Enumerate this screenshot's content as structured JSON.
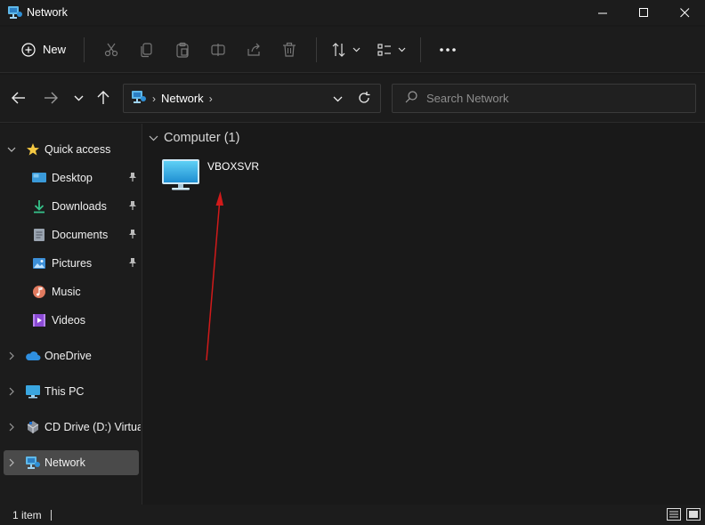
{
  "window": {
    "title": "Network",
    "controls": {
      "minimize": "minimize-icon",
      "maximize": "maximize-icon",
      "close": "close-icon"
    }
  },
  "toolbar": {
    "new_label": "New",
    "icons": [
      "cut-icon",
      "copy-icon",
      "paste-icon",
      "rename-icon",
      "share-icon",
      "delete-icon",
      "sort-icon",
      "view-icon",
      "more-icon"
    ]
  },
  "address": {
    "crumbs": [
      "Network"
    ],
    "search_placeholder": "Search Network"
  },
  "sidebar": {
    "items": [
      {
        "label": "Quick access",
        "icon": "star-icon",
        "expandable": true,
        "expanded": true
      },
      {
        "label": "Desktop",
        "icon": "desktop-folder-icon",
        "pinned": true
      },
      {
        "label": "Downloads",
        "icon": "downloads-icon",
        "pinned": true
      },
      {
        "label": "Documents",
        "icon": "documents-icon",
        "pinned": true
      },
      {
        "label": "Pictures",
        "icon": "pictures-icon",
        "pinned": true
      },
      {
        "label": "Music",
        "icon": "music-icon"
      },
      {
        "label": "Videos",
        "icon": "videos-icon"
      },
      {
        "label": "OneDrive",
        "icon": "cloud-icon",
        "expandable": true
      },
      {
        "label": "This PC",
        "icon": "pc-icon",
        "expandable": true
      },
      {
        "label": "CD Drive (D:) VirtualBox Guest Additions",
        "icon": "cd-drive-icon",
        "expandable": true
      },
      {
        "label": "Network",
        "icon": "network-icon",
        "expandable": true,
        "selected": true
      }
    ]
  },
  "content": {
    "group_title": "Computer (1)",
    "items": [
      {
        "label": "VBOXSVR",
        "icon": "computer-icon"
      }
    ]
  },
  "status": {
    "item_count": "1 item"
  },
  "colors": {
    "background": "#191919",
    "panel": "#1c1c1c",
    "selected": "#4a4a4a",
    "annotation_arrow": "#d11a1a"
  }
}
